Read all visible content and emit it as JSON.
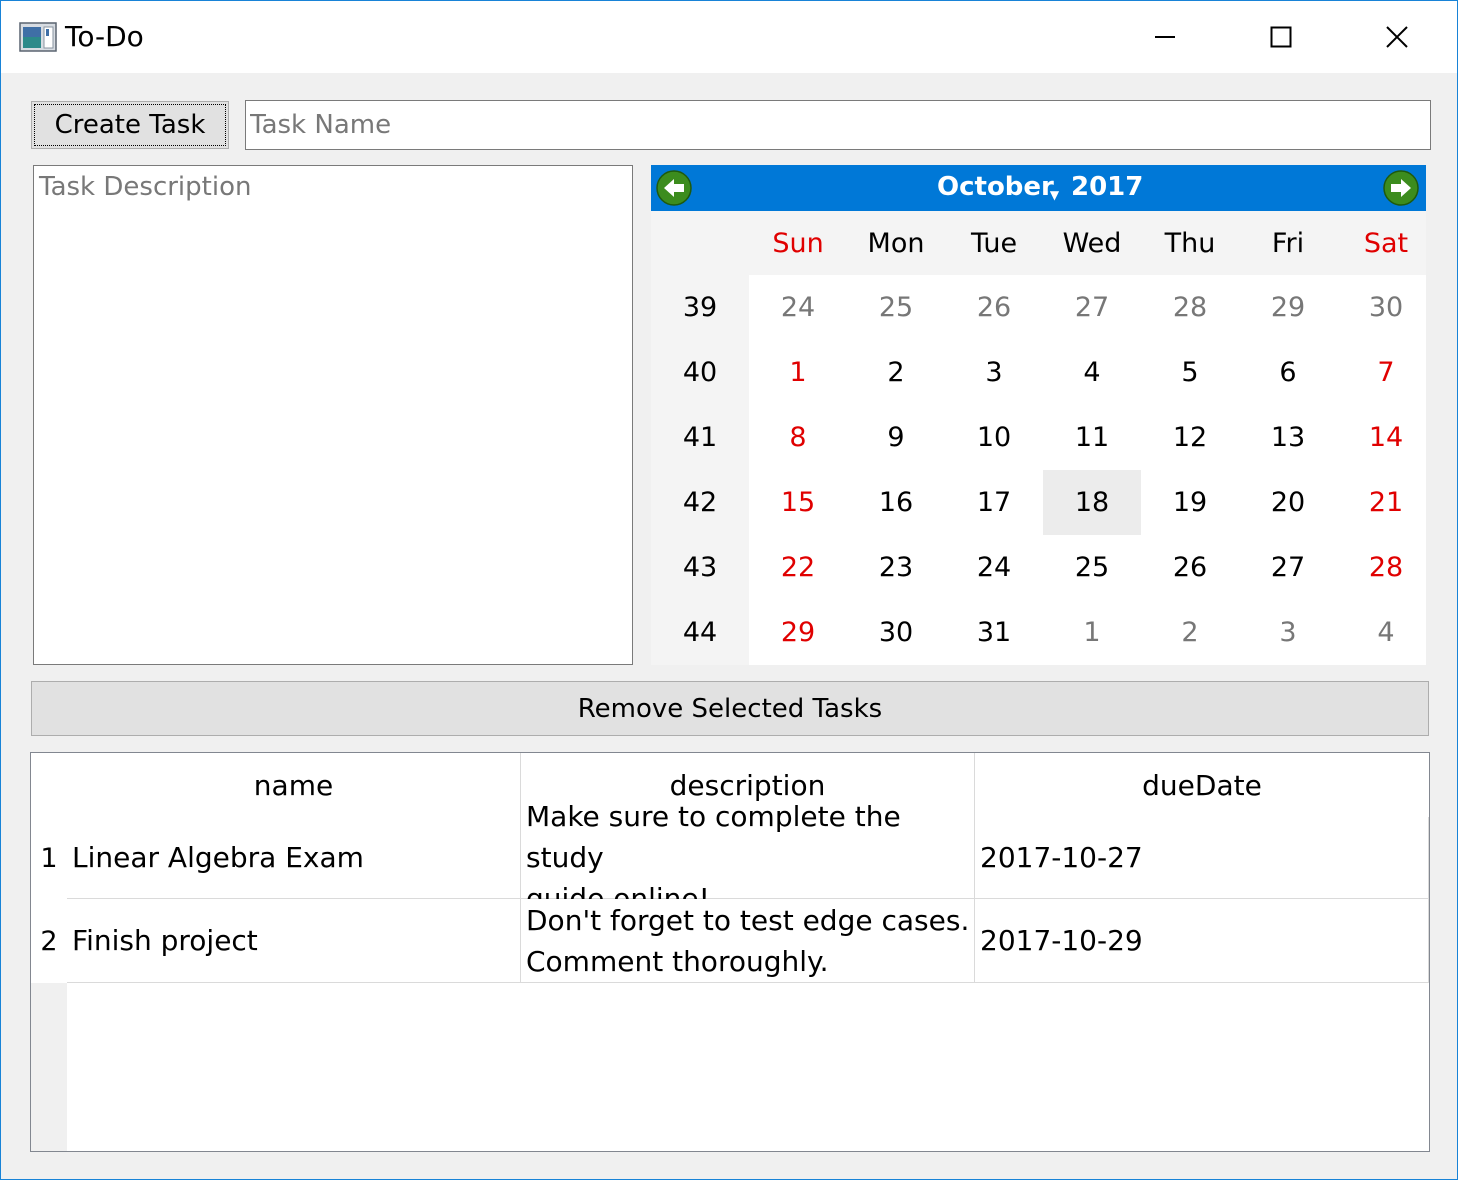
{
  "window": {
    "title": "To-Do",
    "icons": {
      "app": "app-window-icon",
      "minimize": "minimize-icon",
      "maximize": "maximize-icon",
      "close": "close-icon"
    }
  },
  "toolbar": {
    "create_label": "Create Task",
    "task_name_placeholder": "Task Name"
  },
  "description": {
    "placeholder": "Task Description"
  },
  "calendar": {
    "month": "October",
    "year": "2017",
    "selected": "18",
    "colors": {
      "header_bg": "#0078d7",
      "weekend": "#e00000",
      "other_month": "#777777",
      "nav_arrow": "#3c8c1e"
    },
    "weekdays": [
      {
        "label": "Sun",
        "kind": "weekend"
      },
      {
        "label": "Mon",
        "kind": "weekday"
      },
      {
        "label": "Tue",
        "kind": "weekday"
      },
      {
        "label": "Wed",
        "kind": "weekday"
      },
      {
        "label": "Thu",
        "kind": "weekday"
      },
      {
        "label": "Fri",
        "kind": "weekday"
      },
      {
        "label": "Sat",
        "kind": "weekend"
      }
    ],
    "weeks": [
      {
        "num": "39",
        "days": [
          "24",
          "25",
          "26",
          "27",
          "28",
          "29",
          "30"
        ],
        "other": [
          0,
          1,
          2,
          3,
          4,
          5,
          6
        ]
      },
      {
        "num": "40",
        "days": [
          "1",
          "2",
          "3",
          "4",
          "5",
          "6",
          "7"
        ],
        "other": []
      },
      {
        "num": "41",
        "days": [
          "8",
          "9",
          "10",
          "11",
          "12",
          "13",
          "14"
        ],
        "other": []
      },
      {
        "num": "42",
        "days": [
          "15",
          "16",
          "17",
          "18",
          "19",
          "20",
          "21"
        ],
        "other": []
      },
      {
        "num": "43",
        "days": [
          "22",
          "23",
          "24",
          "25",
          "26",
          "27",
          "28"
        ],
        "other": []
      },
      {
        "num": "44",
        "days": [
          "29",
          "30",
          "31",
          "1",
          "2",
          "3",
          "4"
        ],
        "other": [
          3,
          4,
          5,
          6
        ]
      }
    ]
  },
  "remove_label": "Remove Selected Tasks",
  "table": {
    "columns": [
      "name",
      "description",
      "dueDate"
    ],
    "rows": [
      {
        "num": "1",
        "name": "Linear Algebra Exam",
        "description_line1": "Make sure to complete the study",
        "description_line2": "guide online!",
        "dueDate": "2017-10-27"
      },
      {
        "num": "2",
        "name": "Finish project",
        "description_line1": "Don't forget to test edge cases.",
        "description_line2": "Comment thoroughly.",
        "dueDate": "2017-10-29"
      }
    ]
  }
}
